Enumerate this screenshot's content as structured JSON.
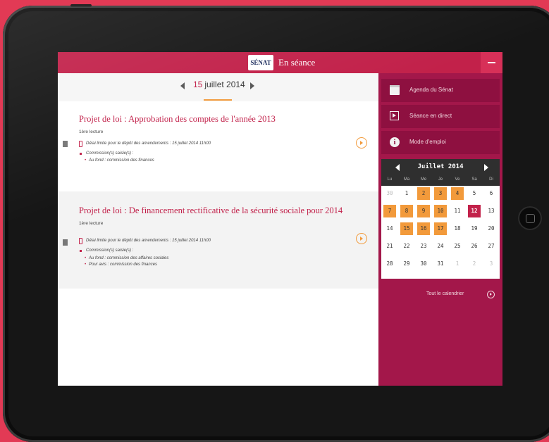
{
  "colors": {
    "brand": "#c2214a",
    "sidebar": "#a3174a",
    "accent": "#f29a3b",
    "bezel": "#161616"
  },
  "topbar": {
    "logo_text": "SÉNAT",
    "title": "En séance"
  },
  "datebar": {
    "day": "15",
    "month_year": "juillet 2014"
  },
  "items": [
    {
      "title": "Projet de loi : Approbation des comptes de l'année 2013",
      "lecture": "1ère lecture",
      "deadline": "Délai limite pour le dépôt des amendements : 15 juillet 2014 11h00",
      "commission_label": "Commission(s) saisie(s) :",
      "commissions": [
        "Au fond : commission des finances"
      ]
    },
    {
      "title": "Projet de loi : De financement rectificative de la sécurité sociale pour 2014",
      "lecture": "1ère lecture",
      "deadline": "Délai limite pour le dépôt des amendements : 15 juillet 2014 11h00",
      "commission_label": "Commission(s) saisie(s) :",
      "commissions": [
        "Au fond : commission des affaires sociales",
        "Pour avis : commission des finances"
      ]
    }
  ],
  "sidebar": {
    "menu": [
      {
        "label": "Agenda du Sénat",
        "icon": "calendar-icon"
      },
      {
        "label": "Séance en direct",
        "icon": "video-play-icon"
      },
      {
        "label": "Mode d'emploi",
        "icon": "info-icon"
      }
    ],
    "calendar": {
      "month": "Juillet 2014",
      "dow": [
        "Lu",
        "Ma",
        "Me",
        "Je",
        "Ve",
        "Sa",
        "Di"
      ],
      "weeks": [
        [
          [
            "30",
            "m"
          ],
          [
            "1",
            ""
          ],
          [
            "2",
            "o"
          ],
          [
            "3",
            "o"
          ],
          [
            "4",
            "o"
          ],
          [
            "5",
            ""
          ],
          [
            "6",
            ""
          ]
        ],
        [
          [
            "7",
            "o"
          ],
          [
            "8",
            "o"
          ],
          [
            "9",
            "o"
          ],
          [
            "10",
            "o"
          ],
          [
            "11",
            ""
          ],
          [
            "12",
            "t"
          ],
          [
            "13",
            ""
          ]
        ],
        [
          [
            "14",
            ""
          ],
          [
            "15",
            "o"
          ],
          [
            "16",
            "o"
          ],
          [
            "17",
            "o"
          ],
          [
            "18",
            ""
          ],
          [
            "19",
            ""
          ],
          [
            "20",
            ""
          ]
        ],
        [
          [
            "21",
            ""
          ],
          [
            "22",
            ""
          ],
          [
            "23",
            ""
          ],
          [
            "24",
            ""
          ],
          [
            "25",
            ""
          ],
          [
            "26",
            ""
          ],
          [
            "27",
            ""
          ]
        ],
        [
          [
            "28",
            ""
          ],
          [
            "29",
            ""
          ],
          [
            "30",
            ""
          ],
          [
            "31",
            ""
          ],
          [
            "1",
            "m"
          ],
          [
            "2",
            "m"
          ],
          [
            "3",
            "m"
          ]
        ]
      ]
    },
    "all_calendar_label": "Tout le calendrier"
  }
}
